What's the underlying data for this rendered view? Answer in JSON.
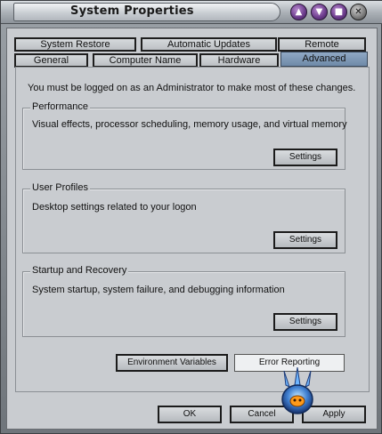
{
  "window": {
    "title": "System Properties",
    "controls": [
      "minimize-icon",
      "restore-icon",
      "maximize-icon",
      "close-icon"
    ]
  },
  "tabs": {
    "row1": [
      {
        "label": "System Restore"
      },
      {
        "label": "Automatic Updates"
      },
      {
        "label": "Remote"
      }
    ],
    "row2": [
      {
        "label": "General"
      },
      {
        "label": "Computer Name"
      },
      {
        "label": "Hardware"
      },
      {
        "label": "Advanced",
        "active": true
      }
    ]
  },
  "intro_text": "You must be logged on as an Administrator to make most of these changes.",
  "groups": {
    "performance": {
      "title": "Performance",
      "description": "Visual effects, processor scheduling, memory usage, and virtual memory",
      "button": "Settings"
    },
    "user_profiles": {
      "title": "User Profiles",
      "description": "Desktop settings related to your logon",
      "button": "Settings"
    },
    "startup_recovery": {
      "title": "Startup and Recovery",
      "description": "System startup, system failure, and debugging information",
      "button": "Settings"
    }
  },
  "extra_buttons": {
    "environment": "Environment Variables",
    "error_reporting": "Error Reporting"
  },
  "footer": {
    "ok": "OK",
    "cancel": "Cancel",
    "apply": "Apply"
  },
  "colors": {
    "active_tab": "#7f98b6",
    "dialog_bg": "#c9ccd0",
    "title_button": "#6a3a8a"
  }
}
